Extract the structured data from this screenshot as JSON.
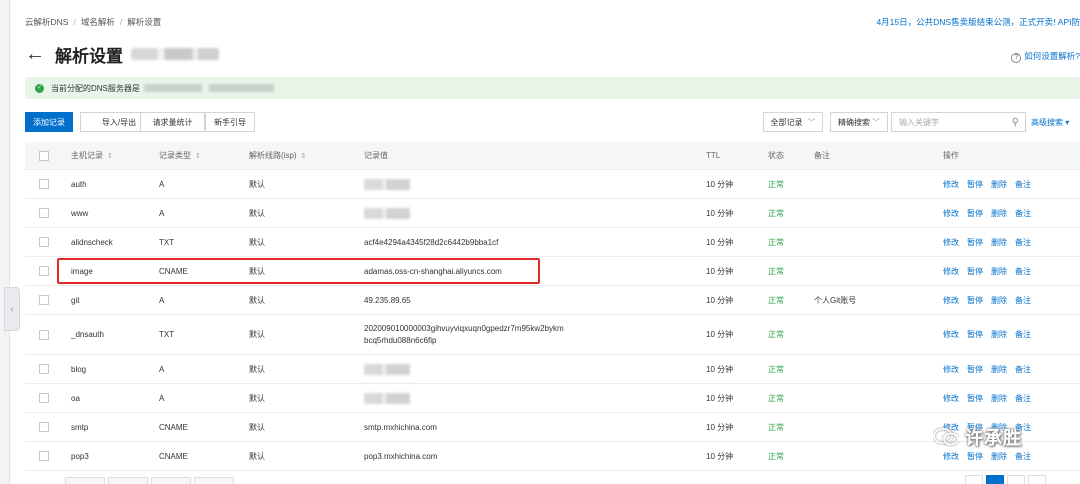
{
  "breadcrumb": [
    "云解析DNS",
    "域名解析",
    "解析设置"
  ],
  "notice": "4月15日，公共DNS售卖版结束公测，正式开卖! API防",
  "page_title": "解析设置",
  "help_link": "如何设置解析?",
  "dns_bar": {
    "text": "当前分配的DNS服务器是"
  },
  "toolbar": {
    "add_record": "添加记录",
    "import_export": "导入/导出",
    "request_stats": "请求量统计",
    "guide": "新手引导",
    "all_records": "全部记录",
    "precise_search": "精确搜索",
    "keyword_placeholder": "输入关键字",
    "advanced_search": "高级搜索"
  },
  "table": {
    "headers": {
      "host": "主机记录",
      "type": "记录类型",
      "line": "解析线路(isp)",
      "value": "记录值",
      "ttl": "TTL",
      "status": "状态",
      "remark": "备注",
      "actions": "操作"
    },
    "actions": [
      "修改",
      "暂停",
      "删除",
      "备注"
    ],
    "rows": [
      {
        "host": "auth",
        "type": "A",
        "line": "默认",
        "value": "",
        "value2": "",
        "ttl": "10 分钟",
        "status": "正常",
        "remark": ""
      },
      {
        "host": "www",
        "type": "A",
        "line": "默认",
        "value": "",
        "value2": "",
        "ttl": "10 分钟",
        "status": "正常",
        "remark": ""
      },
      {
        "host": "alidnscheck",
        "type": "TXT",
        "line": "默认",
        "value": "acf4e4294a4345f28d2c6442b9bba1cf",
        "value2": "",
        "ttl": "10 分钟",
        "status": "正常",
        "remark": ""
      },
      {
        "host": "image",
        "type": "CNAME",
        "line": "默认",
        "value": "adamas.oss-cn-shanghai.aliyuncs.com",
        "value2": "",
        "ttl": "10 分钟",
        "status": "正常",
        "remark": ""
      },
      {
        "host": "git",
        "type": "A",
        "line": "默认",
        "value": "49.235.89.65",
        "value2": "",
        "ttl": "10 分钟",
        "status": "正常",
        "remark": "个人Git账号"
      },
      {
        "host": "_dnsauth",
        "type": "TXT",
        "line": "默认",
        "value": "202009010000003gihvuyviqxuqn0gpedzr7m95kw2bykm",
        "value2": "bcq5rhdu088n6c6fip",
        "ttl": "10 分钟",
        "status": "正常",
        "remark": ""
      },
      {
        "host": "blog",
        "type": "A",
        "line": "默认",
        "value": "",
        "value2": "",
        "ttl": "10 分钟",
        "status": "正常",
        "remark": ""
      },
      {
        "host": "oa",
        "type": "A",
        "line": "默认",
        "value": "",
        "value2": "",
        "ttl": "10 分钟",
        "status": "正常",
        "remark": ""
      },
      {
        "host": "smtp",
        "type": "CNAME",
        "line": "默认",
        "value": "smtp.mxhichina.com",
        "value2": "",
        "ttl": "10 分钟",
        "status": "正常",
        "remark": ""
      },
      {
        "host": "pop3",
        "type": "CNAME",
        "line": "默认",
        "value": "pop3.mxhichina.com",
        "value2": "",
        "ttl": "10 分钟",
        "status": "正常",
        "remark": ""
      }
    ]
  },
  "watermark": "许承胜",
  "colors": {
    "accent": "#0070cc",
    "status_ok": "#2fa34a",
    "highlight": "#e4292b",
    "dns_bar": "#e8f6ea"
  }
}
